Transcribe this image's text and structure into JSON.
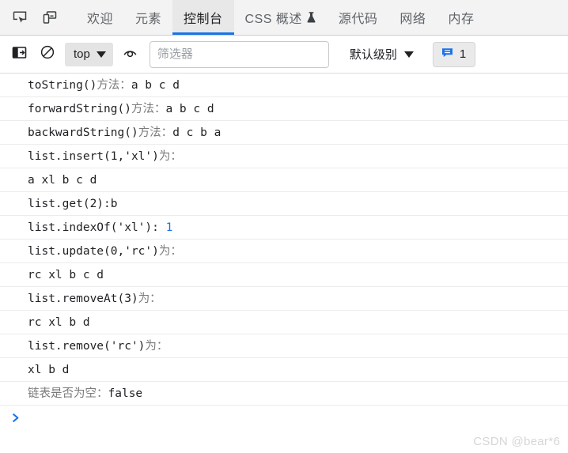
{
  "tabbar": {
    "inspect_icon": "inspect-cursor-icon",
    "device_icon": "device-toolbar-icon",
    "tabs": [
      {
        "label": "欢迎",
        "active": false,
        "name": "tab-welcome"
      },
      {
        "label": "元素",
        "active": false,
        "name": "tab-elements"
      },
      {
        "label": "控制台",
        "active": true,
        "name": "tab-console"
      },
      {
        "label": "CSS 概述",
        "active": false,
        "name": "tab-css-overview",
        "icon": "flask-icon"
      },
      {
        "label": "源代码",
        "active": false,
        "name": "tab-sources"
      },
      {
        "label": "网络",
        "active": false,
        "name": "tab-network"
      },
      {
        "label": "内存",
        "active": false,
        "name": "tab-memory"
      }
    ]
  },
  "toolbar": {
    "sidebar_icon": "console-sidebar-icon",
    "clear_icon": "clear-console-icon",
    "context_label": "top",
    "eye_icon": "live-expression-eye-icon",
    "filter_placeholder": "筛选器",
    "filter_value": "",
    "level_label": "默认级别",
    "message_icon": "message-bubble-icon",
    "message_count": "1"
  },
  "console": {
    "rows": [
      {
        "type": "mixed",
        "parts": [
          {
            "t": "mono",
            "v": "toString()"
          },
          {
            "t": "cjk",
            "v": "方法："
          },
          {
            "t": "mono",
            "v": "a b c d"
          }
        ]
      },
      {
        "type": "mixed",
        "parts": [
          {
            "t": "mono",
            "v": "forwardString()"
          },
          {
            "t": "cjk",
            "v": "方法："
          },
          {
            "t": "mono",
            "v": "a b c d"
          }
        ]
      },
      {
        "type": "mixed",
        "parts": [
          {
            "t": "mono",
            "v": "backwardString()"
          },
          {
            "t": "cjk",
            "v": "方法："
          },
          {
            "t": "mono",
            "v": "d c b a"
          }
        ]
      },
      {
        "type": "mixed",
        "parts": [
          {
            "t": "mono",
            "v": "list.insert(1,'xl')"
          },
          {
            "t": "cjk",
            "v": "为："
          }
        ]
      },
      {
        "type": "mixed",
        "parts": [
          {
            "t": "mono",
            "v": "a xl b c d"
          }
        ]
      },
      {
        "type": "mixed",
        "parts": [
          {
            "t": "mono",
            "v": "list.get(2):b"
          }
        ]
      },
      {
        "type": "mixed",
        "parts": [
          {
            "t": "mono",
            "v": "list.indexOf('xl'): "
          },
          {
            "t": "num",
            "v": "1"
          }
        ]
      },
      {
        "type": "mixed",
        "parts": [
          {
            "t": "mono",
            "v": "list.update(0,'rc')"
          },
          {
            "t": "cjk",
            "v": "为："
          }
        ]
      },
      {
        "type": "mixed",
        "parts": [
          {
            "t": "mono",
            "v": "rc xl b c d"
          }
        ]
      },
      {
        "type": "mixed",
        "parts": [
          {
            "t": "mono",
            "v": "list.removeAt(3)"
          },
          {
            "t": "cjk",
            "v": "为："
          }
        ]
      },
      {
        "type": "mixed",
        "parts": [
          {
            "t": "mono",
            "v": "rc xl b d"
          }
        ]
      },
      {
        "type": "mixed",
        "parts": [
          {
            "t": "mono",
            "v": "list.remove('rc')"
          },
          {
            "t": "cjk",
            "v": "为："
          }
        ]
      },
      {
        "type": "mixed",
        "parts": [
          {
            "t": "mono",
            "v": "xl b d"
          }
        ]
      },
      {
        "type": "mixed",
        "parts": [
          {
            "t": "cjk",
            "v": "链表是否为空："
          },
          {
            "t": "mono",
            "v": "false"
          }
        ]
      }
    ],
    "prompt_glyph": "❯"
  },
  "watermark": "CSDN @bear*6",
  "colors": {
    "accent": "#1a73e8",
    "tab_active_bg": "#e8e8e8",
    "tabbar_bg": "#f3f3f3",
    "row_border": "#ececec",
    "cjk_text": "#7a7a7a",
    "mono_text": "#202124",
    "watermark": "#d6d6d6"
  }
}
